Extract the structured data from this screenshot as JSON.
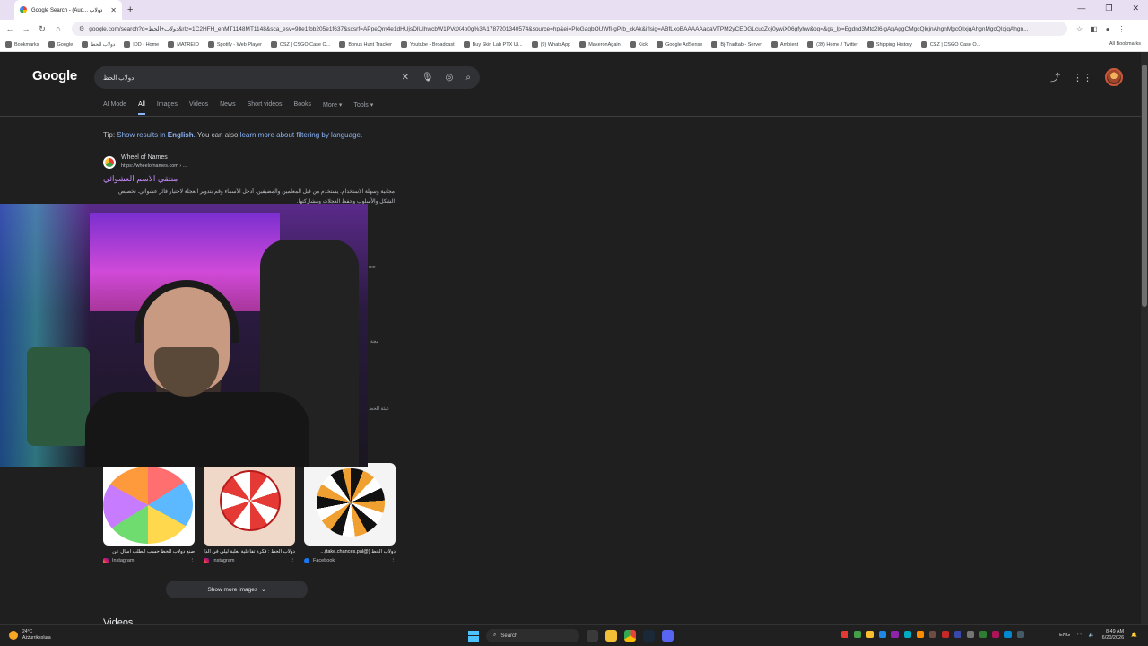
{
  "browser": {
    "tab_title": "Google Search - (Aud... دولاب",
    "url": "google.com/search?q=دولاب+الحظ&rlz=1C2HFH_enMT1148MT1148&sca_esv=98e1fbb205e1f637&sxsrf=APpeQrn4e1dHUjsDlUIhwcbW1PVoX4p0g%3A1787201340574&source=hp&ei=PloGaqbOUWfI-gPrb_ckAk&iflsig=ABfLxoBAAAAAaoaVTPM2yCEDGLcucZoj0ywiX06gfyhw&oq=&gs_lp=Egdnd3Mtd2l6IgAqAggCMgcQIxjnAhgnMgcQIxjqAhgnMgcQIxjqAhgn...",
    "bookmarks": [
      "Bookmarks",
      "Google",
      "دولاب الحظ",
      "IDD - Home",
      "MATREIO",
      "Spotify - Web Player",
      "CSZ | CSGO Case O...",
      "Bonus Hunt Tracker",
      "Youtube - Broadcast",
      "Buy Skin Lab PTX Ul...",
      "(9) WhatsApp",
      "MakeronAgain",
      "Kick",
      "Google AdSense",
      "Bj-Tradtab - Server",
      "Ambient",
      "(39) Home / Twitter",
      "Shipping History",
      "CSZ | CSGO Case O..."
    ],
    "all_bookmarks": "All Bookmarks"
  },
  "google": {
    "logo": "Google",
    "query": "دولاب الحظ",
    "tabs": [
      "AI Mode",
      "All",
      "Images",
      "Videos",
      "News",
      "Short videos",
      "Books",
      "More ▾",
      "Tools ▾"
    ],
    "tip": {
      "prefix": "Tip: ",
      "link1": "Show results in ",
      "english": "English",
      "mid": ". You can also ",
      "link2": "learn more about filtering by language",
      "end": "."
    },
    "result": {
      "site": "Wheel of Names",
      "url": "https://wheelofnames.com › ...",
      "title": "منتقي الاسم العشوائي",
      "snippet": "مجانية وسهلة الاستخدام. يستخدم من قبل المعلمين والمضيفين. أدخل الأسماء وقم بتدوير العجلة لاختيار فائز عشوائي. تخصيص الشكل والأسلوب وحفظ العجلات ومشاركتها."
    },
    "fragments": [
      "me",
      "مجة",
      "عبئة الحظ"
    ],
    "images": [
      {
        "caption": "صنع دولاب الحظ حسب الطلب اسأل عن",
        "source": "Instagram",
        "src_type": "ig"
      },
      {
        "caption": "دولاب الحظ : فكرة تفاعلية لعلبة ليلي في الذا",
        "source": "Instagram",
        "src_type": "ig"
      },
      {
        "caption": "دولاب الحظ (@take.chances.pal)...",
        "source": "Facebook",
        "src_type": "fb"
      }
    ],
    "show_more": "Show more images",
    "videos_heading": "Videos"
  },
  "taskbar": {
    "weather_temp": "24°C",
    "weather_desc": "Ażżurrikkolura",
    "search": "Search",
    "lang": "ENG",
    "time": "8:49 AM",
    "date": "6/20/2026"
  }
}
